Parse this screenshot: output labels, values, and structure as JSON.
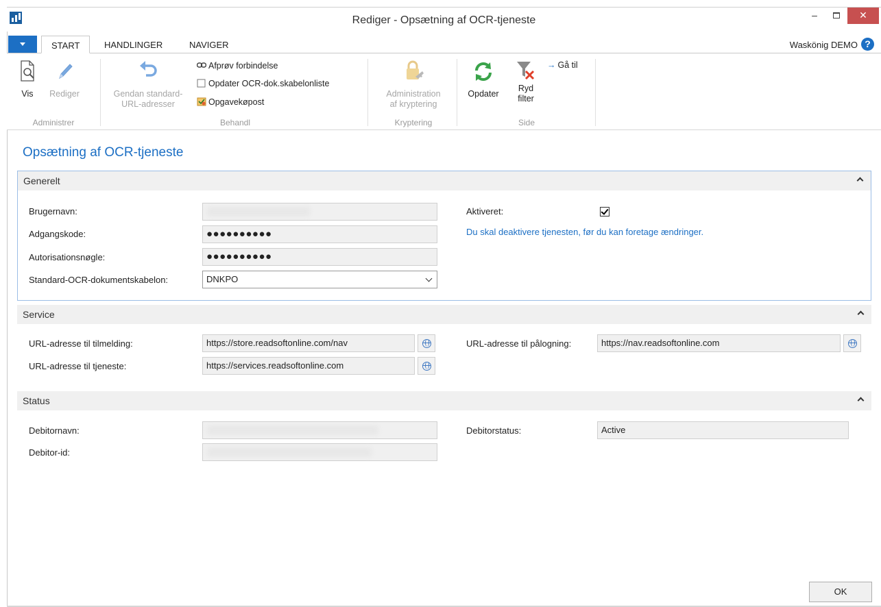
{
  "window": {
    "title": "Rediger - Opsætning af OCR-tjeneste",
    "minimize": "–",
    "maximize": "☐",
    "close": "✕"
  },
  "ribbon_tabs": [
    "START",
    "HANDLINGER",
    "NAVIGER"
  ],
  "active_tab": "START",
  "user": "Waskönig DEMO",
  "help": "?",
  "ribbon": {
    "administrer": {
      "name": "Administrer",
      "vis": "Vis",
      "rediger": "Rediger"
    },
    "behandl": {
      "name": "Behandl",
      "gendan_line1": "Gendan standard-",
      "gendan_line2": "URL-adresser",
      "afprov": "Afprøv forbindelse",
      "opdater_ocr": "Opdater OCR-dok.skabelonliste",
      "opgave": "Opgavekøpost"
    },
    "kryptering": {
      "name": "Kryptering",
      "admin_line1": "Administration",
      "admin_line2": "af kryptering"
    },
    "side": {
      "name": "Side",
      "opdater": "Opdater",
      "ryd_line1": "Ryd",
      "ryd_line2": "filter",
      "gaa_til": "Gå til"
    }
  },
  "page_title": "Opsætning af OCR-tjeneste",
  "generelt": {
    "title": "Generelt",
    "brugernavn_label": "Brugernavn:",
    "adgangskode_label": "Adgangskode:",
    "adgangskode_value": "●●●●●●●●●●",
    "autorisation_label": "Autorisationsnøgle:",
    "autorisation_value": "●●●●●●●●●●",
    "standard_label": "Standard-OCR-dokumentskabelon:",
    "standard_value": "DNKPO",
    "aktiveret_label": "Aktiveret:",
    "aktiveret_checked": true,
    "info_text": "Du skal deaktivere tjenesten, før du kan foretage ændringer."
  },
  "service": {
    "title": "Service",
    "tilmelding_label": "URL-adresse til tilmelding:",
    "tilmelding_value": "https://store.readsoftonline.com/nav",
    "tjeneste_label": "URL-adresse til tjeneste:",
    "tjeneste_value": "https://services.readsoftonline.com",
    "palogning_label": "URL-adresse til pålogning:",
    "palogning_value": "https://nav.readsoftonline.com"
  },
  "status": {
    "title": "Status",
    "debitornavn_label": "Debitornavn:",
    "debitorid_label": "Debitor-id:",
    "debitorstatus_label": "Debitorstatus:",
    "debitorstatus_value": "Active"
  },
  "ok_label": "OK",
  "colors": {
    "accent": "#1c6fc4",
    "close": "#c75050",
    "section_bg": "#f0f0f0"
  }
}
